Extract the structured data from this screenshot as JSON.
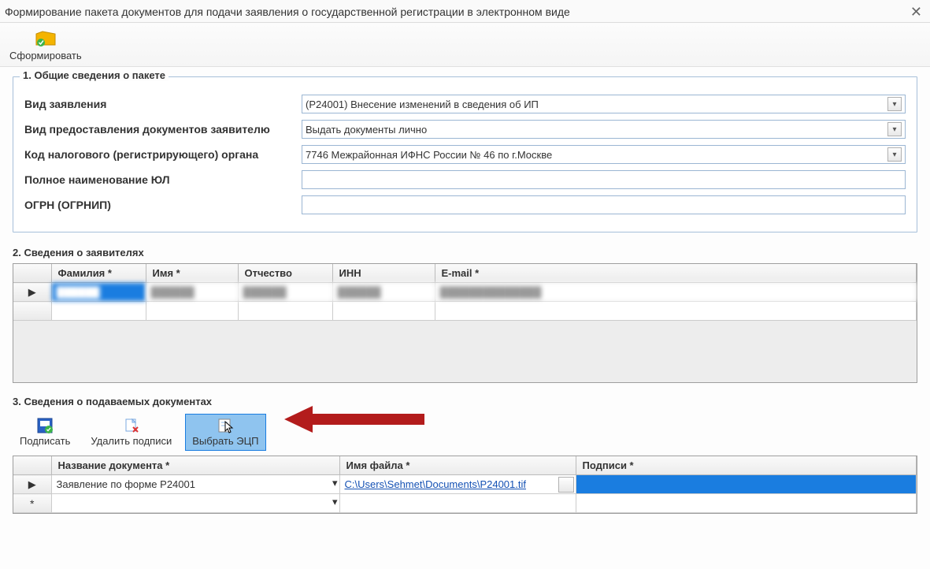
{
  "window": {
    "title": "Формирование пакета документов для подачи заявления о государственной регистрации в электронном виде"
  },
  "toolbar": {
    "form_label": "Сформировать"
  },
  "section1": {
    "title": "1. Общие сведения о пакете",
    "labels": {
      "app_type": "Вид заявления",
      "delivery": "Вид предоставления документов заявителю",
      "tax_code": "Код налогового (регистрирующего) органа",
      "full_name": "Полное наименование ЮЛ",
      "ogrn": "ОГРН (ОГРНИП)"
    },
    "values": {
      "app_type": "(Р24001) Внесение изменений в сведения об ИП",
      "delivery": "Выдать документы лично",
      "tax_code": "7746 Межрайонная ИФНС России № 46 по г.Москве",
      "full_name": "",
      "ogrn": ""
    }
  },
  "section2": {
    "title": "2. Сведения о заявителях",
    "columns": {
      "surname": "Фамилия *",
      "name": "Имя *",
      "patronymic": "Отчество",
      "inn": "ИНН",
      "email": "E-mail *"
    },
    "rows": [
      {
        "surname": "██████",
        "name": "██████",
        "patronymic": "██████",
        "inn": "██████",
        "email": "██████████████"
      }
    ]
  },
  "section3": {
    "title": "3. Сведения о подаваемых документах",
    "toolbar": {
      "sign": "Подписать",
      "delete_sig": "Удалить подписи",
      "select_ecp": "Выбрать ЭЦП"
    },
    "columns": {
      "doc_name": "Название документа *",
      "file_name": "Имя файла *",
      "signatures": "Подписи *"
    },
    "rows": [
      {
        "doc_name": "Заявление по форме P24001",
        "file_name": "C:\\Users\\Sehmet\\Documents\\P24001.tif",
        "signatures": ""
      }
    ]
  }
}
